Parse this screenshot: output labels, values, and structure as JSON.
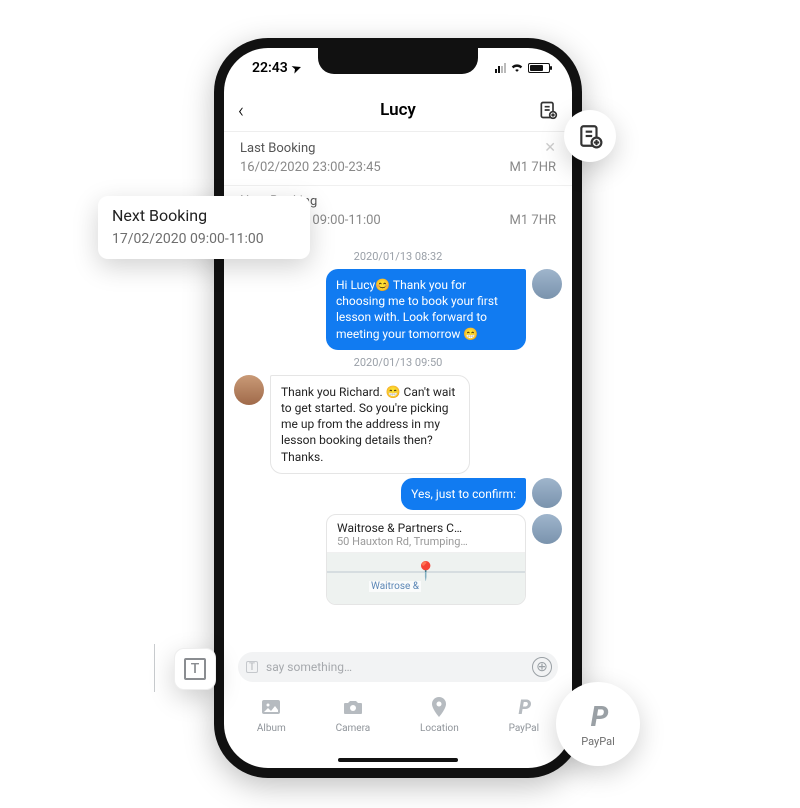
{
  "status": {
    "time": "22:43",
    "nav_glyph": "➤"
  },
  "header": {
    "back_glyph": "‹",
    "title": "Lucy",
    "note_icon_name": "note-add-icon"
  },
  "bookings": {
    "last": {
      "label": "Last Booking",
      "datetime": "16/02/2020 23:00-23:45",
      "code": "M1 7HR"
    },
    "next": {
      "label": "Next Booking",
      "datetime": "17/02/2020 09:00-11:00",
      "code": "M1 7HR"
    }
  },
  "chat": {
    "ts1": "2020/01/13 08:32",
    "msg1": "Hi Lucy😊 Thank you for choosing me to book your first lesson with. Look forward to meeting your tomorrow 😁",
    "ts2": "2020/01/13 09:50",
    "msg2": "Thank you Richard. 😁 Can't wait to get started. So you're picking me up from the address in my lesson booking details then? Thanks.",
    "msg3": "Yes, just to confirm:",
    "location": {
      "title": "Waitrose & Partners C…",
      "subtitle": "50 Hauxton Rd, Trumping…",
      "map_label": "Waitrose &"
    }
  },
  "composer": {
    "placeholder": "say something…"
  },
  "actions": {
    "album": "Album",
    "camera": "Camera",
    "location": "Location",
    "paypal": "PayPal"
  },
  "callouts": {
    "paypal_label": "PayPal",
    "text_icon_char": "T"
  }
}
